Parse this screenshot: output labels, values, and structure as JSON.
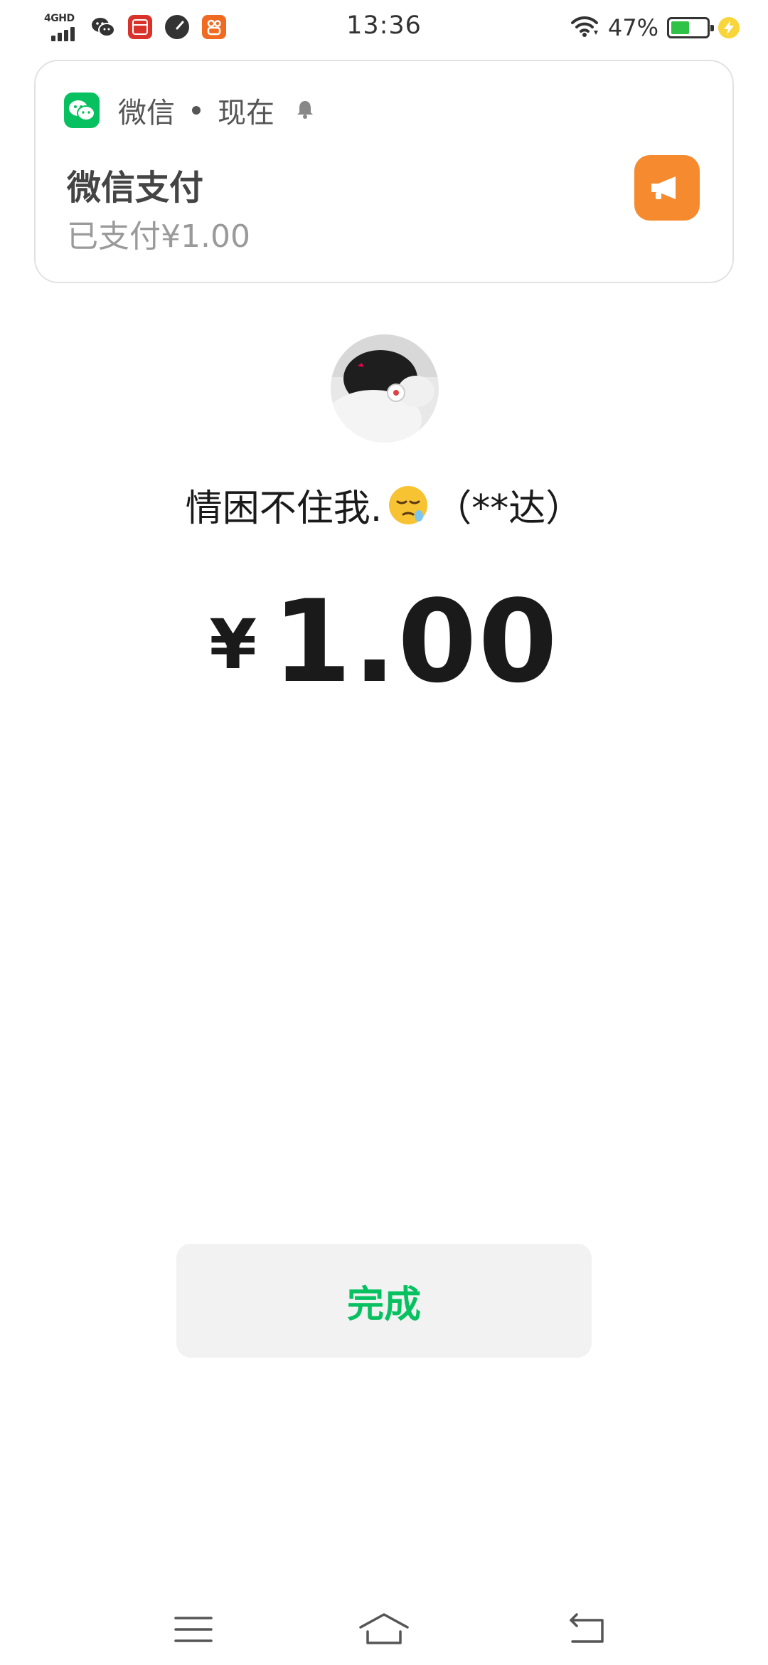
{
  "status_bar": {
    "network": "4GHD",
    "time": "13:36",
    "battery_percent": "47%",
    "battery_level": 0.47,
    "icons": [
      "signal-icon",
      "wechat-icon",
      "calendar-app-icon",
      "gauge-icon",
      "kuaishou-icon",
      "wifi-icon",
      "battery-icon",
      "charging-icon"
    ]
  },
  "notification": {
    "app_name": "微信",
    "time": "现在",
    "title": "微信支付",
    "body": "已支付¥1.00",
    "accent": "#07c160",
    "action_color": "#f58a2e"
  },
  "payee": {
    "name_prefix": "情困不住我.",
    "emoji": "sleepy-face",
    "name_suffix": "（**达）"
  },
  "payment": {
    "currency": "¥",
    "amount": "1.00"
  },
  "done_button": {
    "label": "完成",
    "color": "#07c160"
  },
  "nav_bar": {
    "buttons": [
      "menu-icon",
      "home-icon",
      "back-icon"
    ]
  }
}
